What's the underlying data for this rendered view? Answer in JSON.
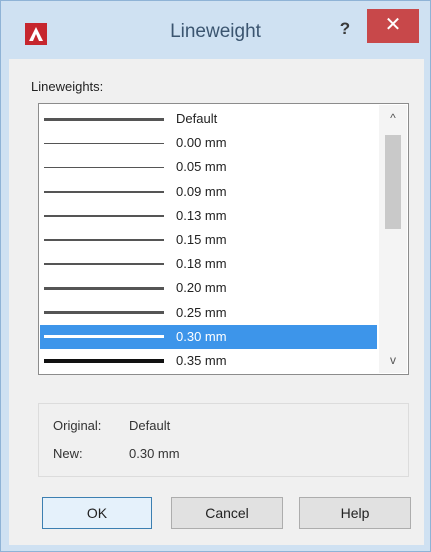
{
  "window": {
    "title": "Lineweight",
    "help_caption": "?",
    "close_caption": "✕"
  },
  "list": {
    "label": "Lineweights:",
    "items": [
      {
        "label": "Default",
        "line_weight_mm": 0.25
      },
      {
        "label": "0.00 mm",
        "line_weight_mm": 0.0
      },
      {
        "label": "0.05 mm",
        "line_weight_mm": 0.05
      },
      {
        "label": "0.09 mm",
        "line_weight_mm": 0.09
      },
      {
        "label": "0.13 mm",
        "line_weight_mm": 0.13
      },
      {
        "label": "0.15 mm",
        "line_weight_mm": 0.15
      },
      {
        "label": "0.18 mm",
        "line_weight_mm": 0.18
      },
      {
        "label": "0.20 mm",
        "line_weight_mm": 0.2
      },
      {
        "label": "0.25 mm",
        "line_weight_mm": 0.25
      },
      {
        "label": "0.30 mm",
        "line_weight_mm": 0.3,
        "selected": true
      },
      {
        "label": "0.35 mm",
        "line_weight_mm": 0.35
      }
    ],
    "scroll": {
      "up_icon": "^",
      "down_icon": "v"
    }
  },
  "info": {
    "original_label": "Original:",
    "original_value": "Default",
    "new_label": "New:",
    "new_value": "0.30 mm"
  },
  "buttons": {
    "ok": "OK",
    "cancel": "Cancel",
    "help": "Help"
  },
  "colors": {
    "selection": "#3d95ea",
    "close_button": "#c8484a",
    "title_text": "#3b5570"
  }
}
